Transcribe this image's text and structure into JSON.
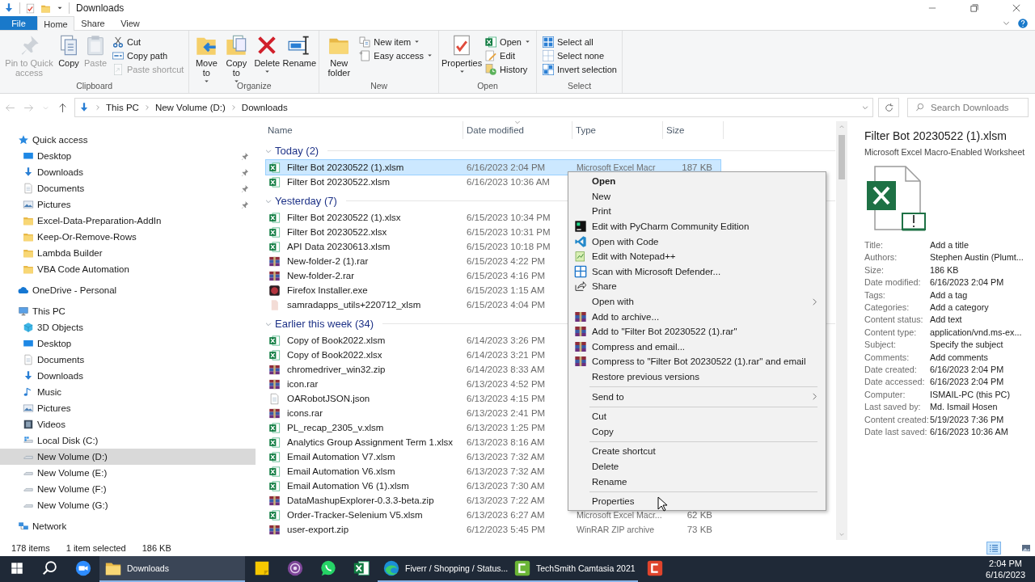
{
  "title_bar": {
    "title": "Downloads"
  },
  "ribbon": {
    "tabs": [
      {
        "label": "File",
        "kind": "file",
        "selected": false
      },
      {
        "label": "Home",
        "kind": "tab",
        "selected": true
      },
      {
        "label": "Share",
        "kind": "tab",
        "selected": false
      },
      {
        "label": "View",
        "kind": "tab",
        "selected": false
      }
    ],
    "groups": [
      {
        "label": "Clipboard",
        "large": [
          {
            "label": "Pin to Quick access",
            "kind": "pin",
            "disabled": true,
            "dropdown": false
          },
          {
            "label": "Copy",
            "kind": "copy",
            "disabled": false,
            "dropdown": false
          },
          {
            "label": "Paste",
            "kind": "paste",
            "disabled": true,
            "dropdown": false
          }
        ],
        "small": [
          {
            "label": "Cut",
            "kind": "cut",
            "disabled": false,
            "dropdown": false
          },
          {
            "label": "Copy path",
            "kind": "copypath",
            "disabled": false,
            "dropdown": false
          },
          {
            "label": "Paste shortcut",
            "kind": "pasteshortcut",
            "disabled": true,
            "dropdown": false
          }
        ]
      },
      {
        "label": "Organize",
        "large": [
          {
            "label": "Move to",
            "kind": "moveto",
            "disabled": false,
            "dropdown": true
          },
          {
            "label": "Copy to",
            "kind": "copyto",
            "disabled": false,
            "dropdown": true
          },
          {
            "label": "Delete",
            "kind": "delete",
            "disabled": false,
            "dropdown": true
          },
          {
            "label": "Rename",
            "kind": "rename",
            "disabled": false,
            "dropdown": false
          }
        ]
      },
      {
        "label": "New",
        "large": [
          {
            "label": "New folder",
            "kind": "newfolder",
            "disabled": false,
            "dropdown": false
          }
        ],
        "small": [
          {
            "label": "New item",
            "kind": "newitem",
            "disabled": false,
            "dropdown": true
          },
          {
            "label": "Easy access",
            "kind": "easyaccess",
            "disabled": false,
            "dropdown": true
          }
        ]
      },
      {
        "label": "Open",
        "large": [
          {
            "label": "Properties",
            "kind": "properties",
            "disabled": false,
            "dropdown": true
          }
        ],
        "small": [
          {
            "label": "Open",
            "kind": "open",
            "disabled": false,
            "dropdown": true
          },
          {
            "label": "Edit",
            "kind": "edit",
            "disabled": false,
            "dropdown": false
          },
          {
            "label": "History",
            "kind": "history",
            "disabled": false,
            "dropdown": false
          }
        ]
      },
      {
        "label": "Select",
        "small": [
          {
            "label": "Select all",
            "kind": "selectall",
            "disabled": false,
            "dropdown": false
          },
          {
            "label": "Select none",
            "kind": "selectnone",
            "disabled": false,
            "dropdown": false
          },
          {
            "label": "Invert selection",
            "kind": "invert",
            "disabled": false,
            "dropdown": false
          }
        ]
      }
    ]
  },
  "address_bar": {
    "breadcrumbs": [
      "This PC",
      "New Volume (D:)",
      "Downloads"
    ],
    "search": {
      "placeholder": "Search Downloads"
    }
  },
  "sidebar": {
    "sections": [
      {
        "label": "Quick access",
        "kind": "star",
        "selected": false,
        "children": [
          {
            "label": "Desktop",
            "kind": "desktop",
            "selected": false,
            "pinned": true
          },
          {
            "label": "Downloads",
            "kind": "download",
            "selected": false,
            "pinned": true
          },
          {
            "label": "Documents",
            "kind": "document",
            "selected": false,
            "pinned": true
          },
          {
            "label": "Pictures",
            "kind": "picture",
            "selected": false,
            "pinned": true
          },
          {
            "label": "Excel-Data-Preparation-AddIn",
            "kind": "folder",
            "selected": false,
            "pinned": false
          },
          {
            "label": "Keep-Or-Remove-Rows",
            "kind": "folder",
            "selected": false,
            "pinned": false
          },
          {
            "label": "Lambda Builder",
            "kind": "folder",
            "selected": false,
            "pinned": false
          },
          {
            "label": "VBA Code Automation",
            "kind": "folder",
            "selected": false,
            "pinned": false
          }
        ]
      },
      {
        "label": "OneDrive - Personal",
        "kind": "cloud",
        "selected": false
      },
      {
        "label": "This PC",
        "kind": "computer",
        "selected": false,
        "children": [
          {
            "label": "3D Objects",
            "kind": "cube",
            "selected": false
          },
          {
            "label": "Desktop",
            "kind": "desktop",
            "selected": false
          },
          {
            "label": "Documents",
            "kind": "document",
            "selected": false
          },
          {
            "label": "Downloads",
            "kind": "download",
            "selected": false
          },
          {
            "label": "Music",
            "kind": "music",
            "selected": false
          },
          {
            "label": "Pictures",
            "kind": "picture",
            "selected": false
          },
          {
            "label": "Videos",
            "kind": "video",
            "selected": false
          },
          {
            "label": "Local Disk (C:)",
            "kind": "disk",
            "selected": false
          },
          {
            "label": "New Volume (D:)",
            "kind": "drive",
            "selected": true
          },
          {
            "label": "New Volume (E:)",
            "kind": "drive",
            "selected": false
          },
          {
            "label": "New Volume (F:)",
            "kind": "drive",
            "selected": false
          },
          {
            "label": "New Volume (G:)",
            "kind": "drive",
            "selected": false
          }
        ]
      },
      {
        "label": "Network",
        "kind": "network",
        "selected": false
      }
    ]
  },
  "file_list": {
    "columns": [
      {
        "label": "Name",
        "sorted": false
      },
      {
        "label": "Date modified",
        "sorted": true
      },
      {
        "label": "Type",
        "sorted": false
      },
      {
        "label": "Size",
        "sorted": false
      }
    ],
    "groups": [
      {
        "label": "Today (2)",
        "expanded": true,
        "rows": [
          {
            "name": "Filter Bot 20230522 (1).xlsm",
            "kind": "excel",
            "date": "6/16/2023 2:04 PM",
            "type": "Microsoft Excel Macr",
            "size": "187 KB",
            "selected": true
          },
          {
            "name": "Filter Bot 20230522.xlsm",
            "kind": "excel",
            "date": "6/16/2023 10:36 AM",
            "selected": false
          }
        ]
      },
      {
        "label": "Yesterday (7)",
        "expanded": true,
        "rows": [
          {
            "name": "Filter Bot 20230522 (1).xlsx",
            "kind": "excel",
            "date": "6/15/2023 10:34 PM",
            "selected": false
          },
          {
            "name": "Filter Bot 20230522.xlsx",
            "kind": "excel",
            "date": "6/15/2023 10:31 PM",
            "selected": false
          },
          {
            "name": "API Data 20230613.xlsm",
            "kind": "excel",
            "date": "6/15/2023 10:18 PM",
            "selected": false
          },
          {
            "name": "New-folder-2 (1).rar",
            "kind": "archive",
            "date": "6/15/2023 4:22 PM",
            "selected": false
          },
          {
            "name": "New-folder-2.rar",
            "kind": "archive",
            "date": "6/15/2023 4:16 PM",
            "selected": false
          },
          {
            "name": "Firefox Installer.exe",
            "kind": "exe",
            "date": "6/15/2023 1:15 AM",
            "selected": false
          },
          {
            "name": "samradapps_utils+220712_xlsm",
            "kind": "file",
            "date": "6/15/2023 4:04 PM",
            "selected": false
          }
        ]
      },
      {
        "label": "Earlier this week (34)",
        "expanded": true,
        "rows": [
          {
            "name": "Copy of Book2022.xlsm",
            "kind": "excel",
            "date": "6/14/2023 3:26 PM",
            "selected": false
          },
          {
            "name": "Copy of Book2022.xlsx",
            "kind": "excel",
            "date": "6/14/2023 3:21 PM",
            "selected": false
          },
          {
            "name": "chromedriver_win32.zip",
            "kind": "archive",
            "date": "6/14/2023 8:33 AM",
            "selected": false
          },
          {
            "name": "icon.rar",
            "kind": "archive",
            "date": "6/13/2023 4:52 PM",
            "selected": false
          },
          {
            "name": "OARobotJSON.json",
            "kind": "json",
            "date": "6/13/2023 4:15 PM",
            "selected": false
          },
          {
            "name": "icons.rar",
            "kind": "archive",
            "date": "6/13/2023 2:41 PM",
            "selected": false
          },
          {
            "name": "PL_recap_2305_v.xlsm",
            "kind": "excel",
            "date": "6/13/2023 1:25 PM",
            "selected": false
          },
          {
            "name": "Analytics Group Assignment Term 1.xlsx",
            "kind": "excel",
            "date": "6/13/2023 8:16 AM",
            "selected": false
          },
          {
            "name": "Email Automation V7.xlsm",
            "kind": "excel",
            "date": "6/13/2023 7:32 AM",
            "selected": false
          },
          {
            "name": "Email Automation V6.xlsm",
            "kind": "excel",
            "date": "6/13/2023 7:32 AM",
            "selected": false
          },
          {
            "name": "Email Automation V6 (1).xlsm",
            "kind": "excel",
            "date": "6/13/2023 7:30 AM",
            "selected": false
          },
          {
            "name": "DataMashupExplorer-0.3.3-beta.zip",
            "kind": "archive",
            "date": "6/13/2023 7:22 AM",
            "selected": false
          },
          {
            "name": "Order-Tracker-Selenium V5.xlsm",
            "kind": "excel",
            "date": "6/13/2023 6:27 AM",
            "type": "Microsoft Excel Macr...",
            "size": "62 KB",
            "selected": false
          },
          {
            "name": "user-export.zip",
            "kind": "archive",
            "date": "6/12/2023 5:45 PM",
            "type": "WinRAR ZIP archive",
            "size": "73 KB",
            "selected": false
          }
        ]
      }
    ]
  },
  "context_menu": {
    "sections": [
      {
        "items": [
          {
            "label": "Open",
            "kind": "default",
            "submenu": false
          },
          {
            "label": "New",
            "kind": "plain",
            "submenu": false
          },
          {
            "label": "Print",
            "kind": "plain",
            "submenu": false
          },
          {
            "label": "Edit with PyCharm Community Edition",
            "kind": "pycharm",
            "submenu": false
          },
          {
            "label": "Open with Code",
            "kind": "vscode",
            "submenu": false
          },
          {
            "label": "Edit with Notepad++",
            "kind": "notepad",
            "submenu": false
          },
          {
            "label": "Scan with Microsoft Defender...",
            "kind": "defender",
            "submenu": false
          },
          {
            "label": "Share",
            "kind": "share",
            "submenu": false
          },
          {
            "label": "Open with",
            "kind": "plain",
            "submenu": true
          },
          {
            "label": "Add to archive...",
            "kind": "winrar",
            "submenu": false
          },
          {
            "label": "Add to \"Filter Bot 20230522 (1).rar\"",
            "kind": "winrar",
            "submenu": false
          },
          {
            "label": "Compress and email...",
            "kind": "winrar",
            "submenu": false
          },
          {
            "label": "Compress to \"Filter Bot 20230522 (1).rar\" and email",
            "kind": "winrar",
            "submenu": false
          },
          {
            "label": "Restore previous versions",
            "kind": "plain",
            "submenu": false
          }
        ]
      },
      {
        "items": [
          {
            "label": "Send to",
            "kind": "plain",
            "submenu": true
          }
        ]
      },
      {
        "items": [
          {
            "label": "Cut",
            "kind": "plain",
            "submenu": false
          },
          {
            "label": "Copy",
            "kind": "plain",
            "submenu": false
          }
        ]
      },
      {
        "items": [
          {
            "label": "Create shortcut",
            "kind": "plain",
            "submenu": false
          },
          {
            "label": "Delete",
            "kind": "plain",
            "submenu": false
          },
          {
            "label": "Rename",
            "kind": "plain",
            "submenu": false
          }
        ]
      },
      {
        "items": [
          {
            "label": "Properties",
            "kind": "plain",
            "submenu": false
          }
        ]
      }
    ]
  },
  "details_pane": {
    "title": "Filter Bot 20230522 (1).xlsm",
    "subtitle": "Microsoft Excel Macro-Enabled Worksheet",
    "properties": [
      {
        "label": "Title:",
        "value": "Add a title"
      },
      {
        "label": "Authors:",
        "value": "Stephen Austin (Plumt..."
      },
      {
        "label": "Size:",
        "value": "186 KB"
      },
      {
        "label": "Date modified:",
        "value": "6/16/2023 2:04 PM"
      },
      {
        "label": "Tags:",
        "value": "Add a tag"
      },
      {
        "label": "Categories:",
        "value": "Add a category"
      },
      {
        "label": "Content status:",
        "value": "Add text"
      },
      {
        "label": "Content type:",
        "value": "application/vnd.ms-ex..."
      },
      {
        "label": "Subject:",
        "value": "Specify the subject"
      },
      {
        "label": "Comments:",
        "value": "Add comments"
      },
      {
        "label": "Date created:",
        "value": "6/16/2023 2:04 PM"
      },
      {
        "label": "Date accessed:",
        "value": "6/16/2023 2:04 PM"
      },
      {
        "label": "Computer:",
        "value": "ISMAIL-PC (this PC)"
      },
      {
        "label": "Last saved by:",
        "value": "Md. Ismail Hosen"
      },
      {
        "label": "Content created:",
        "value": "5/19/2023 7:36 PM"
      },
      {
        "label": "Date last saved:",
        "value": "6/16/2023 10:36 AM"
      }
    ]
  },
  "status_bar": {
    "item_count": "178 items",
    "selection": "1 item selected",
    "selection_size": "186 KB",
    "views": [
      {
        "kind": "details",
        "selected": true
      },
      {
        "kind": "large",
        "selected": false
      }
    ]
  },
  "taskbar": {
    "items": [
      {
        "kind": "start",
        "active": false
      },
      {
        "kind": "search",
        "active": false
      },
      {
        "kind": "zoom",
        "active": false
      },
      {
        "kind": "explorer",
        "label": "Downloads",
        "active": true
      },
      {
        "kind": "sticky",
        "active": false
      },
      {
        "kind": "tor",
        "active": false
      },
      {
        "kind": "whatsapp",
        "active": false
      },
      {
        "kind": "excel",
        "active": false
      },
      {
        "kind": "edge",
        "label": "Fiverr / Shopping / Status...",
        "active": false
      },
      {
        "kind": "camtasia",
        "label": "TechSmith Camtasia 2021",
        "active": false
      },
      {
        "kind": "recorder",
        "active": false
      }
    ],
    "time": "2:04 PM",
    "date": "6/16/2023"
  }
}
